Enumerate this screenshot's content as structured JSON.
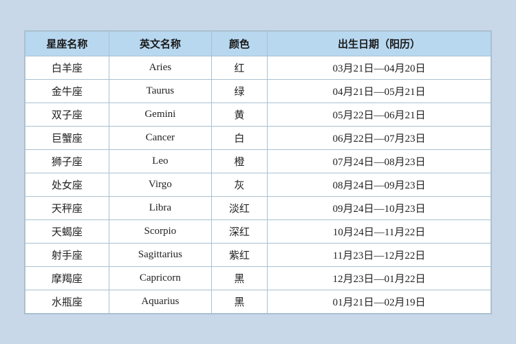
{
  "table": {
    "headers": [
      "星座名称",
      "英文名称",
      "颜色",
      "出生日期（阳历）"
    ],
    "rows": [
      {
        "zh": "白羊座",
        "en": "Aries",
        "color": "红",
        "date": "03月21日—04月20日"
      },
      {
        "zh": "金牛座",
        "en": "Taurus",
        "color": "绿",
        "date": "04月21日—05月21日"
      },
      {
        "zh": "双子座",
        "en": "Gemini",
        "color": "黄",
        "date": "05月22日—06月21日"
      },
      {
        "zh": "巨蟹座",
        "en": "Cancer",
        "color": "白",
        "date": "06月22日—07月23日"
      },
      {
        "zh": "狮子座",
        "en": "Leo",
        "color": "橙",
        "date": "07月24日—08月23日"
      },
      {
        "zh": "处女座",
        "en": "Virgo",
        "color": "灰",
        "date": "08月24日—09月23日"
      },
      {
        "zh": "天秤座",
        "en": "Libra",
        "color": "淡红",
        "date": "09月24日—10月23日"
      },
      {
        "zh": "天蝎座",
        "en": "Scorpio",
        "color": "深红",
        "date": "10月24日—11月22日"
      },
      {
        "zh": "射手座",
        "en": "Sagittarius",
        "color": "紫红",
        "date": "11月23日—12月22日"
      },
      {
        "zh": "摩羯座",
        "en": "Capricorn",
        "color": "黑",
        "date": "12月23日—01月22日"
      },
      {
        "zh": "水瓶座",
        "en": "Aquarius",
        "color": "黑",
        "date": "01月21日—02月19日"
      }
    ]
  }
}
